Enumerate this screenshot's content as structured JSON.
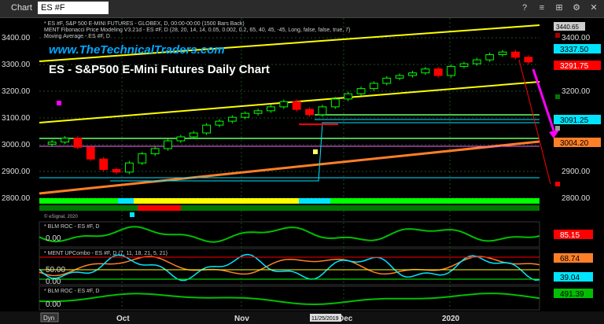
{
  "window": {
    "title": "Chart",
    "symbol": "ES #F",
    "buttons": [
      "?",
      "≡",
      "⊞",
      "⚙",
      "✕"
    ]
  },
  "main_pane": {
    "legend_lines": [
      "* ES #F, S&P 500 E-MINI FUTURES - GLOBEX, D, 00:00-00:00 (1500 Bars Back)",
      "MENT Fibonacci Price Modeling V3.21d - ES #F, D (28, 20, 14, 14, 0.05, 0.002, 0.2, 65, 40, 45, -45, Long, false, false, true, 7)",
      "Moving Average - ES #F, D"
    ],
    "watermark_url": "www.TheTechnicalTraders.com",
    "watermark_title": "ES - S&P500 E-Mini Futures Daily Chart",
    "credit": "© eSignal, 2020",
    "y_ticks": [
      "3400.00",
      "3300.00",
      "3200.00",
      "3100.00",
      "3000.00",
      "2900.00",
      "2800.00"
    ],
    "price_flags": [
      {
        "text": "3440.65",
        "bg": "#cccccc",
        "fg": "#000000"
      },
      {
        "text": "3337.50",
        "bg": "#00e5ff",
        "fg": "#000000"
      },
      {
        "text": "3291.75",
        "bg": "#ff0000",
        "fg": "#ffffff"
      },
      {
        "text": "3091.25",
        "bg": "#00e5ff",
        "fg": "#000000"
      },
      {
        "text": "3004.20",
        "bg": "#ff7f27",
        "fg": "#000000"
      }
    ]
  },
  "panes": [
    {
      "legend": "* BLM ROC - ES #F, D",
      "y_ticks": [
        "0.00"
      ],
      "value": "85.15",
      "value_bg": "#ff0000",
      "value_fg": "#ffffff"
    },
    {
      "legend": "* MENT UPCombo - ES #F, D (7, 11, 18, 21, 5, 21)",
      "y_ticks": [
        "50.00",
        "0.00"
      ],
      "value": "68.74",
      "value_bg": "#ff7f27",
      "value_fg": "#000000",
      "value2": "39.04",
      "value2_bg": "#00e5ff",
      "value2_fg": "#000000"
    },
    {
      "legend": "* BLM ROC - ES #F, D",
      "y_ticks": [
        "0.00"
      ],
      "value": "491.39",
      "value_bg": "#00c000",
      "value_fg": "#000000"
    }
  ],
  "x_axis": {
    "labels": [
      "Oct",
      "Nov",
      "Dec",
      "2020"
    ],
    "cursor_date": "11/25/2019",
    "corner_button": "Dyn"
  },
  "colors": {
    "up_candle": "#00ff00",
    "down_candle": "#ff0000",
    "channel": "#ffff00",
    "trend": "#ff7f27",
    "magenta": "#ff00ff"
  },
  "chart_data": {
    "type": "candlestick",
    "x": [
      "Oct",
      "Nov",
      "Dec",
      "2020"
    ],
    "ylim": [
      2740,
      3460
    ],
    "series": [
      {
        "name": "ES #F",
        "values": [
          2985,
          3000,
          2965,
          2920,
          2880,
          2870,
          2905,
          2940,
          2960,
          2990,
          3005,
          3020,
          3050,
          3065,
          3080,
          3095,
          3105,
          3120,
          3140,
          3110,
          3090,
          3120,
          3150,
          3170,
          3190,
          3210,
          3230,
          3240,
          3250,
          3265,
          3240,
          3275,
          3285,
          3300,
          3320,
          3330,
          3310,
          3292
        ]
      }
    ]
  }
}
